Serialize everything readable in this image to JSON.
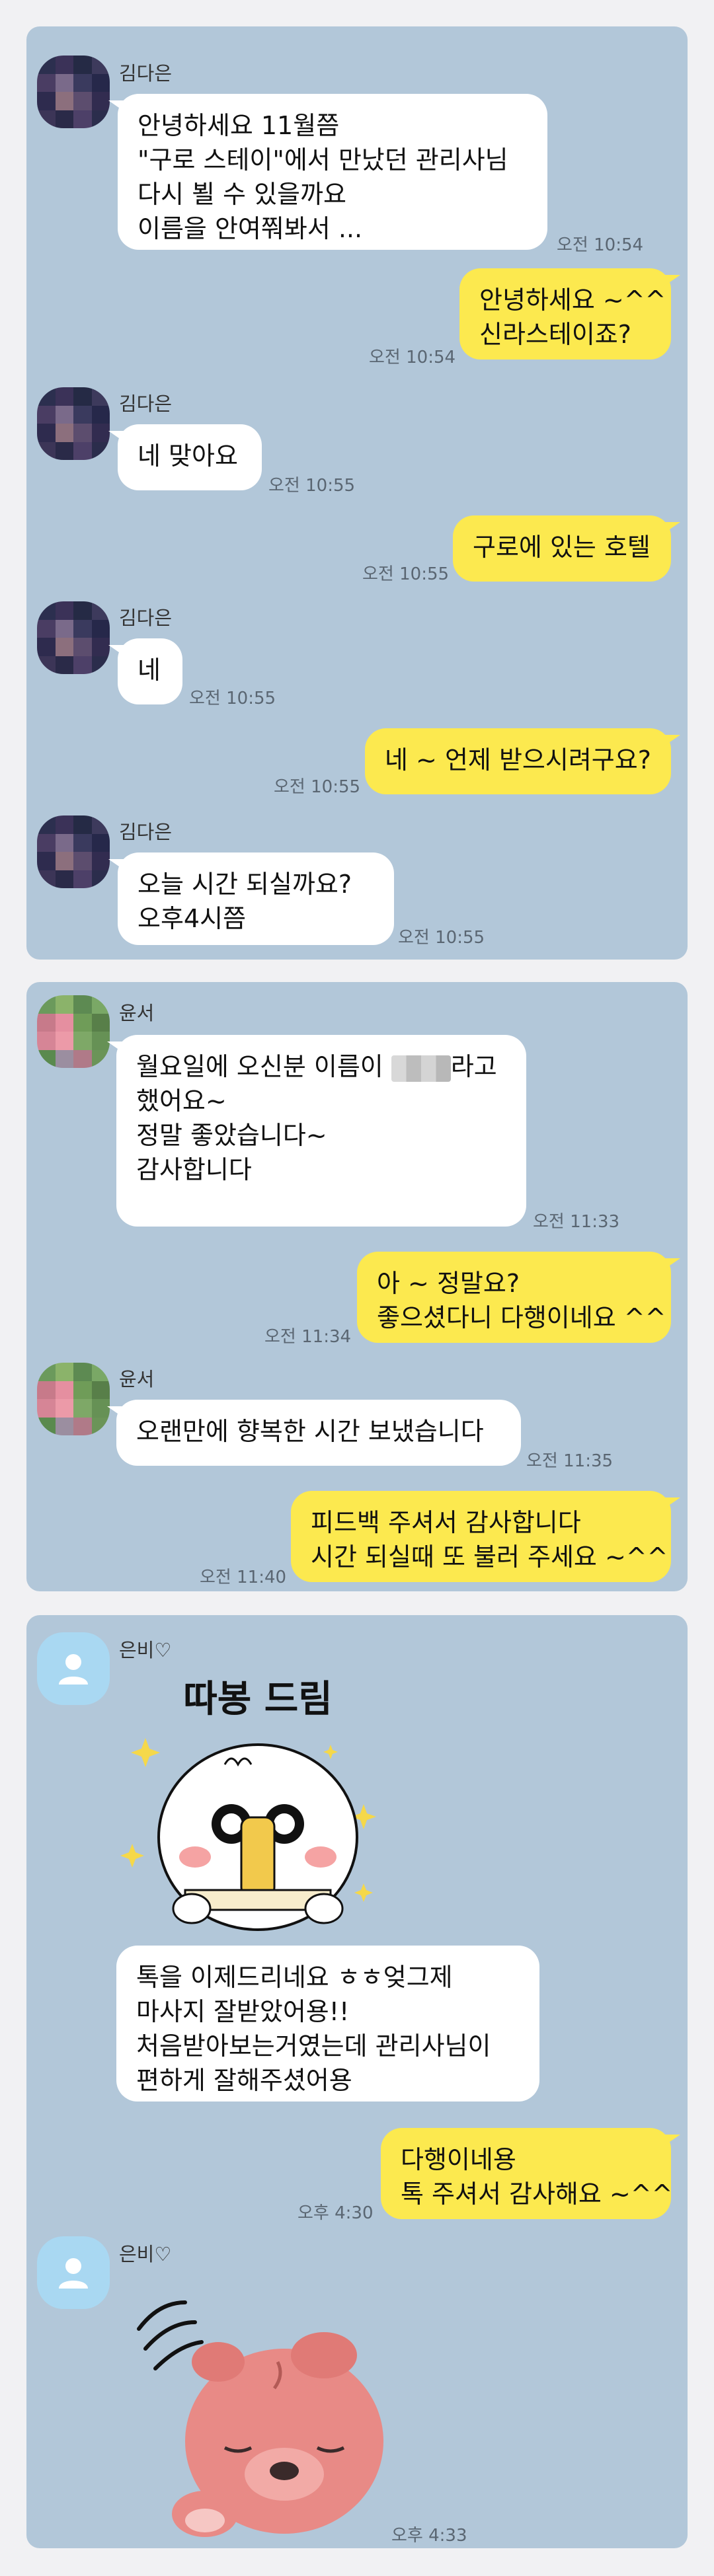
{
  "chat1": {
    "sender": "김다은",
    "groups": [
      {
        "lines": [
          "안녕하세요 11월쯤",
          "\"구로 스테이\"에서 만났던 관리사님",
          "다시 뵐 수 있을까요",
          "이름을 안여쭤봐서 ..."
        ],
        "time": "오전 10:54"
      },
      {
        "lines": [
          "네 맞아요"
        ],
        "time": "오전 10:55"
      },
      {
        "lines": [
          "네"
        ],
        "time": "오전 10:55"
      },
      {
        "lines": [
          "오늘  시간 되실까요?",
          "오후4시쯤"
        ],
        "time": "오전 10:55"
      }
    ],
    "replies": [
      {
        "lines": [
          "안녕하세요 ~^^",
          "신라스테이죠?"
        ],
        "time": "오전 10:54"
      },
      {
        "lines": [
          "구로에 있는 호텔"
        ],
        "time": "오전 10:55"
      },
      {
        "lines": [
          "네 ~ 언제 받으시려구요?"
        ],
        "time": "오전 10:55"
      }
    ]
  },
  "chat2": {
    "sender": "윤서",
    "msg1": {
      "part1": "월요일에 오신분 이름이 ",
      "part2": "라고",
      "lines": [
        "했어요~",
        "정말 좋았습니다~",
        "감사합니다"
      ],
      "time": "오전 11:33"
    },
    "reply1": {
      "lines": [
        "아 ~ 정말요?",
        "좋으셨다니 다행이네요 ^^"
      ],
      "time": "오전 11:34"
    },
    "msg2": {
      "lines": [
        "오랜만에 향복한 시간 보냈습니다"
      ],
      "time": "오전 11:35"
    },
    "reply2": {
      "lines": [
        "피드백 주셔서 감사합니다",
        "시간 되실때 또 불러 주세요 ~^^"
      ],
      "time": "오전 11:40"
    }
  },
  "chat3": {
    "sender": "은비♡",
    "sticker1_text": "따봉 드림",
    "msg1": {
      "lines": [
        "톡을 이제드리네요 ㅎㅎ엊그제",
        "마사지 잘받았어용!!",
        "처음받아보는거였는데 관리사님이",
        "편하게 잘해주셨어용"
      ]
    },
    "reply1": {
      "lines": [
        "다행이네용",
        "톡 주셔서 감사해요 ~^^"
      ],
      "time": "오후 4:30"
    },
    "sender2": "은비♡",
    "sticker2_time": "오후 4:33"
  },
  "colors": {
    "panel": "#b2c7d9",
    "outgoing": "#fce94f",
    "incoming": "#ffffff"
  }
}
